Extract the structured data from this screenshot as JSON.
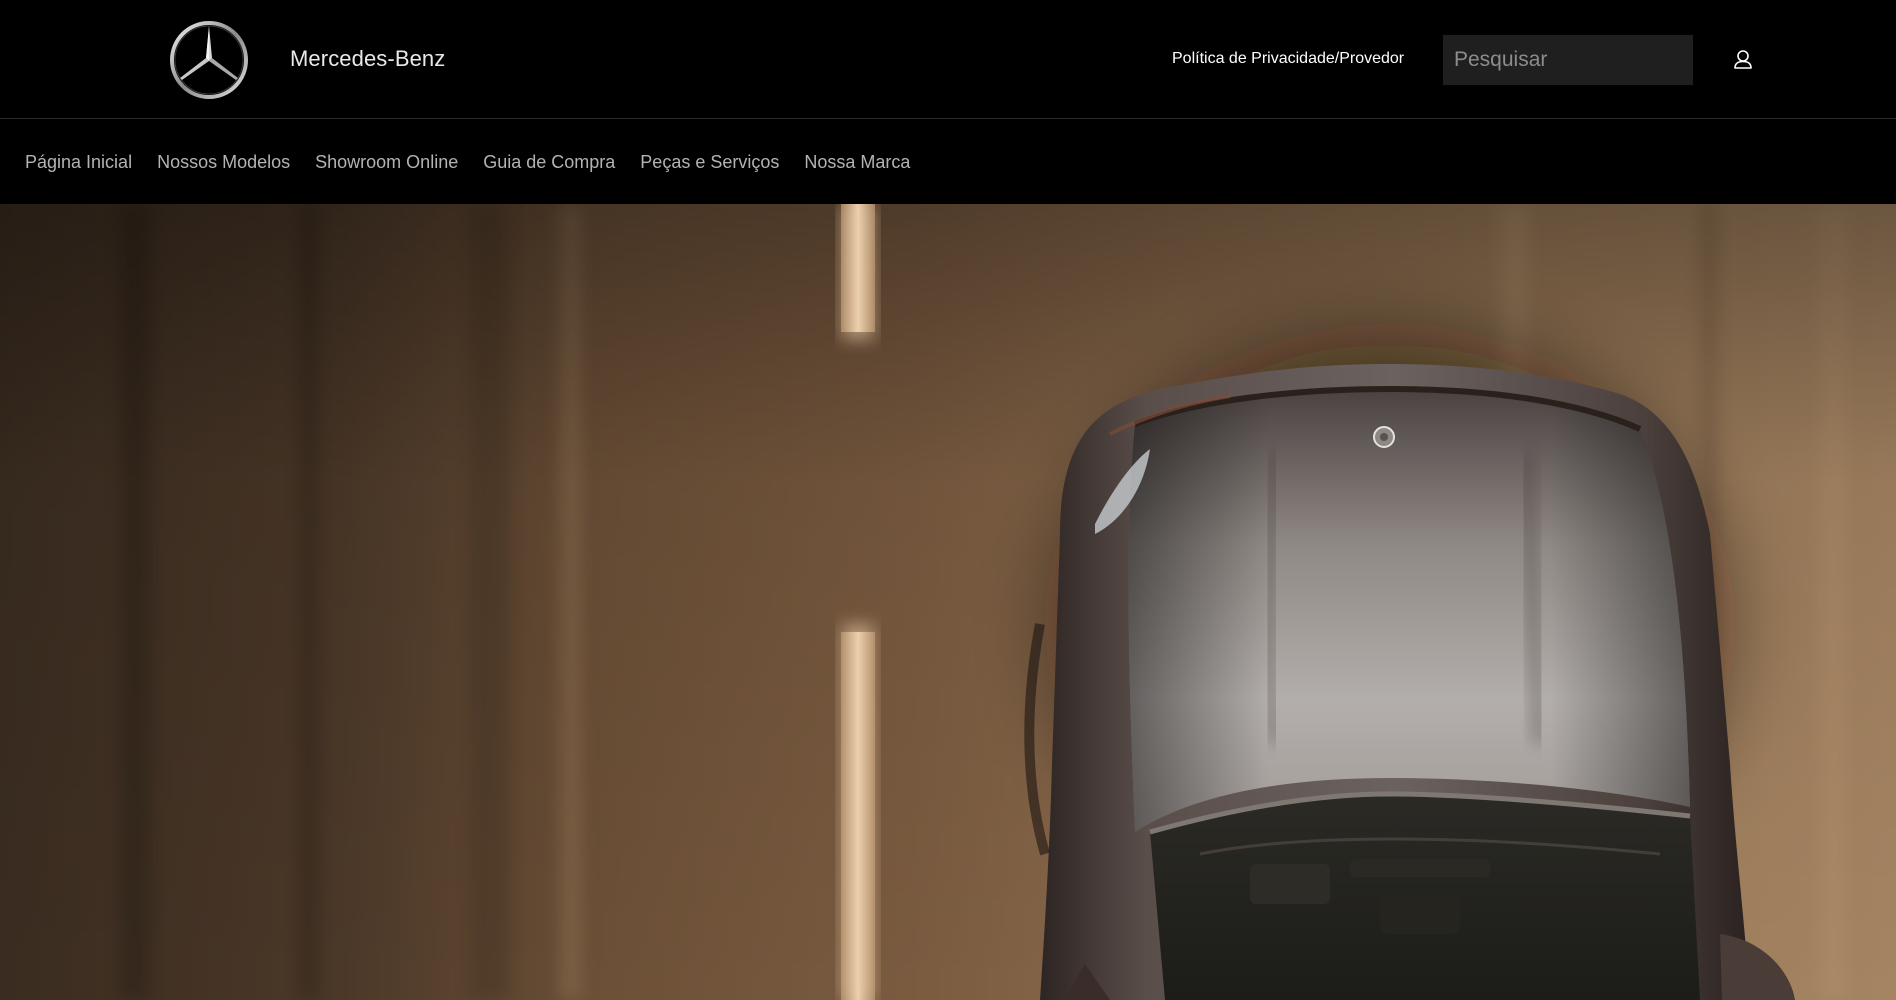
{
  "header": {
    "logo_icon": "mercedes-star-icon",
    "brand_name": "Mercedes-Benz",
    "privacy_link": "Política de Privacidade/Provedor",
    "search": {
      "placeholder": "Pesquisar",
      "value": ""
    },
    "user_icon": "user-icon"
  },
  "nav": {
    "items": [
      {
        "label": "Página Inicial"
      },
      {
        "label": "Nossos Modelos"
      },
      {
        "label": "Showroom Online"
      },
      {
        "label": "Guia de Compra"
      },
      {
        "label": "Peças e Serviços"
      },
      {
        "label": "Nossa Marca"
      }
    ]
  },
  "hero": {
    "image": "car-top-view-on-road",
    "colors": {
      "road_dark": "#2e2319",
      "road_mid": "#6e5239",
      "road_light": "#a07e5c",
      "lane_marking": "#e2c3a0",
      "car_body": "#5d5350",
      "car_hood_highlight": "#b7b1ad"
    }
  },
  "colors": {
    "background": "#000000",
    "nav_text": "#b3b3b3",
    "search_bg": "#1f1f1f"
  }
}
